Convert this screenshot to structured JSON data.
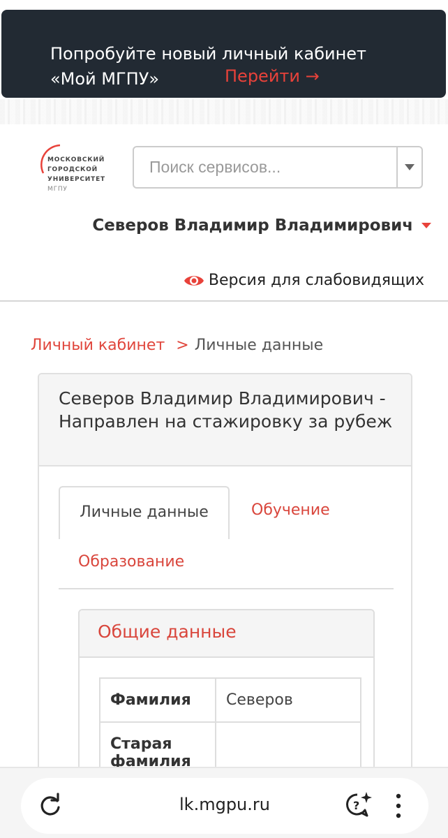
{
  "banner": {
    "text": "Попробуйте новый личный кабинет «Мой МГПУ»",
    "link": "Перейти →"
  },
  "logo": {
    "line1": "МОСКОВСКИЙ",
    "line2": "ГОРОДСКОЙ",
    "line3": "УНИВЕРСИТЕТ",
    "line4": "МГПУ"
  },
  "search": {
    "placeholder": "Поиск сервисов..."
  },
  "user": {
    "name": "Северов Владимир Владимирович"
  },
  "accessibility": {
    "label": "Версия для слабовидящих"
  },
  "breadcrumb": {
    "home": "Личный кабинет",
    "separator": ">",
    "current": "Личные данные"
  },
  "card": {
    "title": "Северов Владимир Владимирович - Направлен на стажировку за рубеж",
    "tabs": [
      {
        "label": "Личные данные",
        "active": true
      },
      {
        "label": "Обучение",
        "active": false
      },
      {
        "label": "Образование",
        "active": false
      }
    ],
    "panel": {
      "title": "Общие данные",
      "rows": [
        {
          "key": "Фамилия",
          "value": "Северов"
        },
        {
          "key": "Старая фамилия",
          "value": ""
        }
      ]
    }
  },
  "browser": {
    "url": "lk.mgpu.ru"
  },
  "colors": {
    "accent": "#e8423a",
    "banner_bg": "#222a33"
  }
}
